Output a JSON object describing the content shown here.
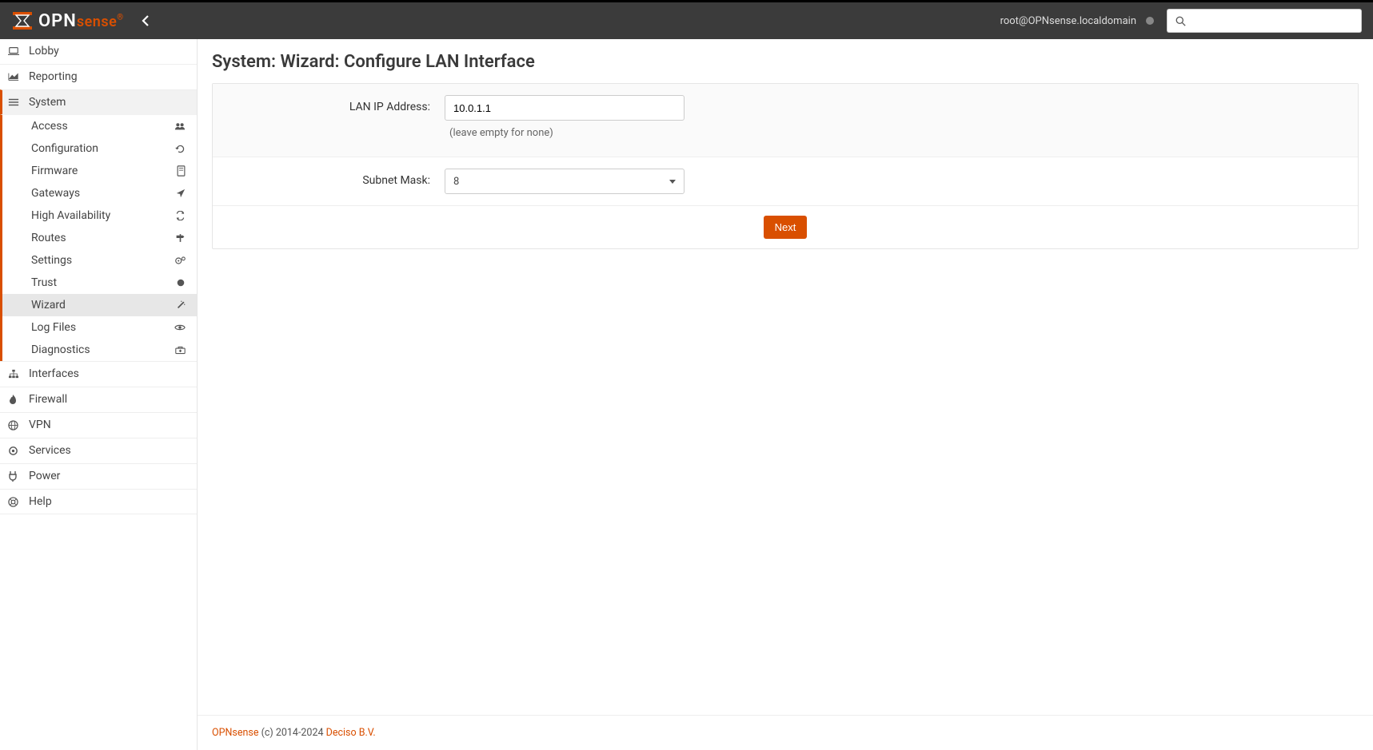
{
  "header": {
    "brand_main": "OPN",
    "brand_accent": "sense",
    "user_label": "root@OPNsense.localdomain"
  },
  "sidebar": {
    "main": [
      {
        "label": "Lobby"
      },
      {
        "label": "Reporting"
      },
      {
        "label": "System"
      },
      {
        "label": "Interfaces"
      },
      {
        "label": "Firewall"
      },
      {
        "label": "VPN"
      },
      {
        "label": "Services"
      },
      {
        "label": "Power"
      },
      {
        "label": "Help"
      }
    ],
    "system_sub": [
      {
        "label": "Access"
      },
      {
        "label": "Configuration"
      },
      {
        "label": "Firmware"
      },
      {
        "label": "Gateways"
      },
      {
        "label": "High Availability"
      },
      {
        "label": "Routes"
      },
      {
        "label": "Settings"
      },
      {
        "label": "Trust"
      },
      {
        "label": "Wizard"
      },
      {
        "label": "Log Files"
      },
      {
        "label": "Diagnostics"
      }
    ]
  },
  "page": {
    "title": "System: Wizard: Configure LAN Interface",
    "lan_ip_label": "LAN IP Address:",
    "lan_ip_value": "10.0.1.1",
    "lan_ip_hint": "(leave empty for none)",
    "subnet_label": "Subnet Mask:",
    "subnet_value": "8",
    "next_button": "Next"
  },
  "footer": {
    "brand": "OPNsense",
    "mid": " (c) 2014-2024 ",
    "company": "Deciso B.V."
  }
}
